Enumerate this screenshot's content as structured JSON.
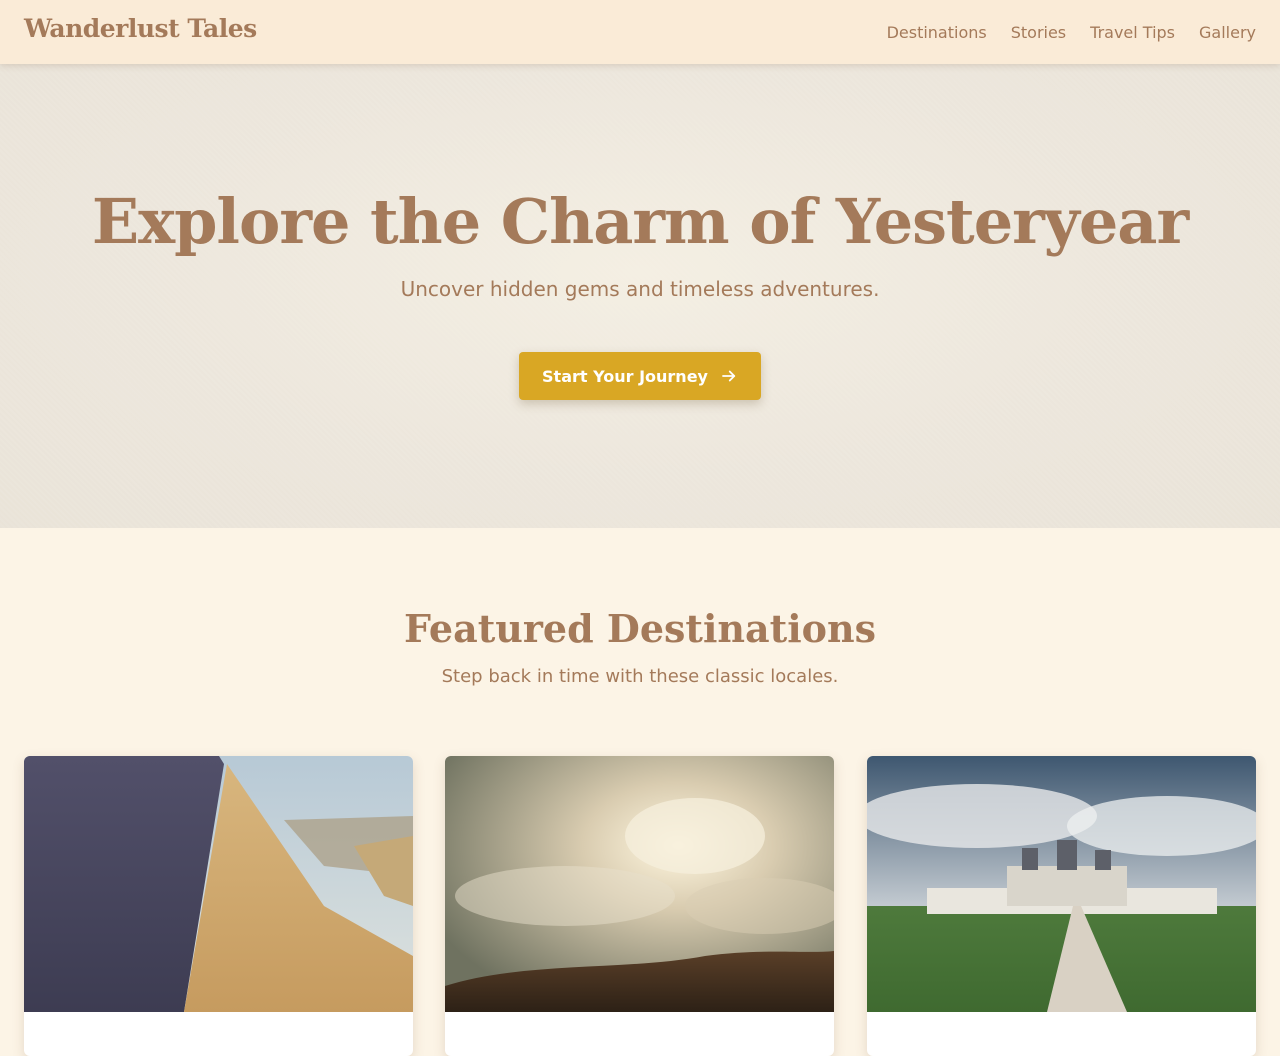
{
  "header": {
    "logo": "Wanderlust Tales",
    "nav": [
      "Destinations",
      "Stories",
      "Travel Tips",
      "Gallery"
    ]
  },
  "hero": {
    "title": "Explore the Charm of Yesteryear",
    "subtitle": "Uncover hidden gems and timeless adventures.",
    "cta_label": "Start Your Journey",
    "cta_icon": "arrow-right-icon"
  },
  "featured": {
    "title": "Featured Destinations",
    "subtitle": "Step back in time with these classic locales.",
    "cards": [
      {
        "image": "desert-dune-photo"
      },
      {
        "image": "sunrays-clouds-photo"
      },
      {
        "image": "chateau-photo"
      }
    ]
  },
  "colors": {
    "header_bg": "#faebd7",
    "text": "#a47a5a",
    "accent_button": "#d9a724",
    "page_bg": "#fcf4e6",
    "hero_bg": "#ece6dc"
  }
}
